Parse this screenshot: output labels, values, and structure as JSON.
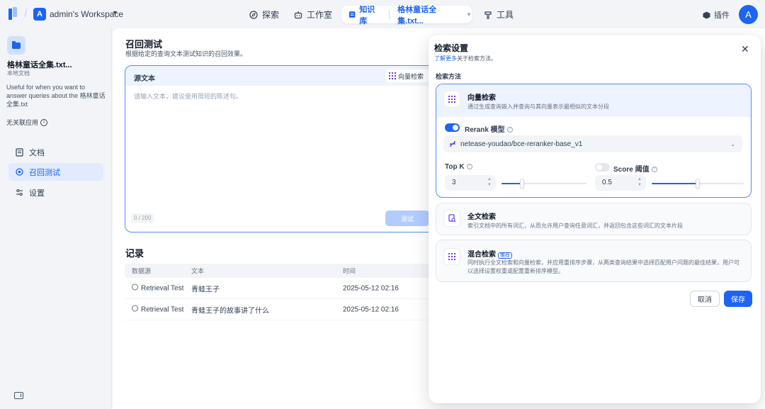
{
  "topbar": {
    "workspace_initial": "A",
    "workspace_name": "admin's Workspace",
    "nav": {
      "explore": "探索",
      "studio": "工作室",
      "knowledge": "知识库",
      "current_doc": "格林童话全集.txt...",
      "tools": "工具",
      "plugins": "插件"
    },
    "user_initial": "A"
  },
  "sidebar": {
    "dataset_name": "格林童话全集.txt...",
    "dataset_type": "本地文档",
    "description": "Useful for when you want to answer queries about the 格林童话全集.txt",
    "related_apps": "无关联应用",
    "items": [
      {
        "label": "文档",
        "icon": "document-icon"
      },
      {
        "label": "召回测试",
        "icon": "target-icon"
      },
      {
        "label": "设置",
        "icon": "settings-icon"
      }
    ]
  },
  "main": {
    "title": "召回测试",
    "description": "根据给定的查询文本测试知识的召回效果。",
    "source": {
      "label": "源文本",
      "method_label": "向量检索",
      "placeholder": "请输入文本，建议使用简短的陈述句。",
      "count": "0 / 200",
      "button": "测试"
    },
    "records": {
      "title": "记录",
      "headers": [
        "数据源",
        "文本",
        "时间"
      ],
      "rows": [
        {
          "source": "Retrieval Test",
          "text": "青蛙王子",
          "time": "2025-05-12 02:16"
        },
        {
          "source": "Retrieval Test",
          "text": "青蛙王子的故事讲了什么",
          "time": "2025-05-12 02:16"
        }
      ]
    }
  },
  "panel": {
    "title": "检索设置",
    "learn_more": "了解更多",
    "subtitle_rest": "关于检索方法。",
    "method_label": "检索方法",
    "vector": {
      "name": "向量检索",
      "desc": "通过生成查询嵌入并查询与其向量表示最相似的文本分段",
      "rerank_label": "Rerank 模型",
      "rerank_enabled": true,
      "model": "netease-youdao/bce-reranker-base_v1",
      "topk_label": "Top K",
      "topk_value": "3",
      "topk_fraction": 0.24,
      "score_label": "Score 阈值",
      "score_enabled": false,
      "score_value": "0.5",
      "score_fraction": 0.5
    },
    "fulltext": {
      "name": "全文检索",
      "desc": "索引文档中的所有词汇，从而允许用户查询任意词汇，并返回包含这些词汇的文本片段"
    },
    "hybrid": {
      "name": "混合检索",
      "badge": "推荐",
      "desc": "同时执行全文检索和向量检索，并应用重排序步骤，从两类查询结果中选择匹配用户问题的最佳结果，用户可以选择设置权重或配置重新排序模型。"
    },
    "cancel": "取消",
    "save": "保存"
  },
  "colors": {
    "accent": "#1c64f2",
    "accent_light": "#eef4ff",
    "purple": "#6938ef",
    "arrow": "#e5403a"
  }
}
